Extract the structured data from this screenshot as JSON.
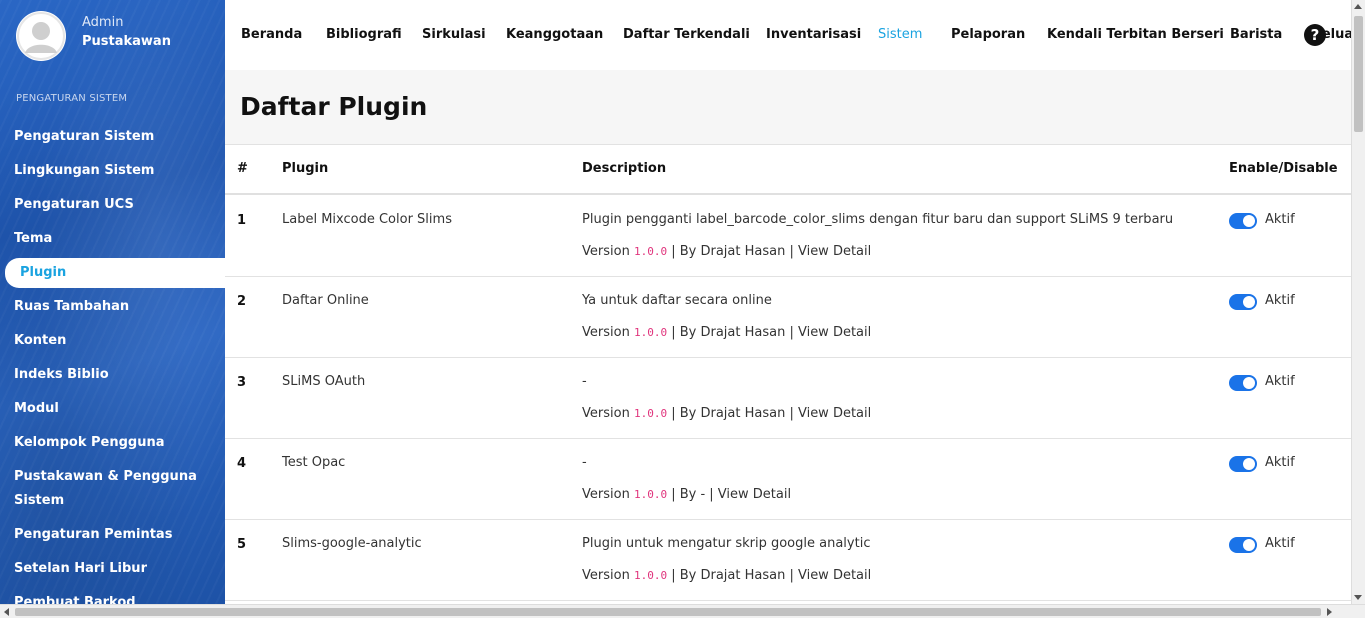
{
  "profile": {
    "role": "Admin",
    "name": "Pustakawan",
    "avatar_icon": "user-avatar-icon"
  },
  "sidebar": {
    "section_label": "PENGATURAN SISTEM",
    "items": [
      {
        "label": "Pengaturan Sistem"
      },
      {
        "label": "Lingkungan Sistem"
      },
      {
        "label": "Pengaturan UCS"
      },
      {
        "label": "Tema"
      },
      {
        "label": "Plugin",
        "active": true
      },
      {
        "label": "Ruas Tambahan"
      },
      {
        "label": "Konten"
      },
      {
        "label": "Indeks Biblio"
      },
      {
        "label": "Modul"
      },
      {
        "label": "Kelompok Pengguna"
      },
      {
        "label": "Pustakawan & Pengguna Sistem"
      },
      {
        "label": "Pengaturan Pemintas"
      },
      {
        "label": "Setelan Hari Libur"
      },
      {
        "label": "Pembuat Barkod"
      }
    ]
  },
  "topnav": {
    "items": [
      {
        "label": "Beranda"
      },
      {
        "label": "Bibliografi"
      },
      {
        "label": "Sirkulasi"
      },
      {
        "label": "Keanggotaan"
      },
      {
        "label": "Daftar Terkendali"
      },
      {
        "label": "Inventarisasi"
      },
      {
        "label": "Sistem",
        "active": true
      },
      {
        "label": "Pelaporan"
      },
      {
        "label": "Kendali Terbitan Berseri"
      },
      {
        "label": "Barista"
      },
      {
        "label": "Keluar"
      }
    ],
    "help_icon": "?",
    "active_color": "#1aa3e0"
  },
  "page": {
    "title": "Daftar Plugin"
  },
  "table": {
    "headers": {
      "num": "#",
      "plugin": "Plugin",
      "description": "Description",
      "enable": "Enable/Disable"
    },
    "rows": [
      {
        "num": "1",
        "plugin": "Label Mixcode Color Slims",
        "description": "Plugin pengganti label_barcode_color_slims dengan fitur baru dan support SLiMS 9 terbaru",
        "version_prefix": "Version",
        "version": "1.0.0",
        "by": "| By Drajat Hasan | View Detail",
        "status": "Aktif"
      },
      {
        "num": "2",
        "plugin": "Daftar Online",
        "description": "Ya untuk daftar secara online",
        "version_prefix": "Version",
        "version": "1.0.0",
        "by": "| By Drajat Hasan | View Detail",
        "status": "Aktif"
      },
      {
        "num": "3",
        "plugin": "SLiMS OAuth",
        "description": "-",
        "version_prefix": "Version",
        "version": "1.0.0",
        "by": "| By Drajat Hasan | View Detail",
        "status": "Aktif"
      },
      {
        "num": "4",
        "plugin": "Test Opac",
        "description": "-",
        "version_prefix": "Version",
        "version": "1.0.0",
        "by": "| By - | View Detail",
        "status": "Aktif"
      },
      {
        "num": "5",
        "plugin": "Slims-google-analytic",
        "description": "Plugin untuk mengatur skrip google analytic",
        "version_prefix": "Version",
        "version": "1.0.0",
        "by": "| By Drajat Hasan | View Detail",
        "status": "Aktif"
      }
    ],
    "toggle_color": "#1a73e8"
  }
}
